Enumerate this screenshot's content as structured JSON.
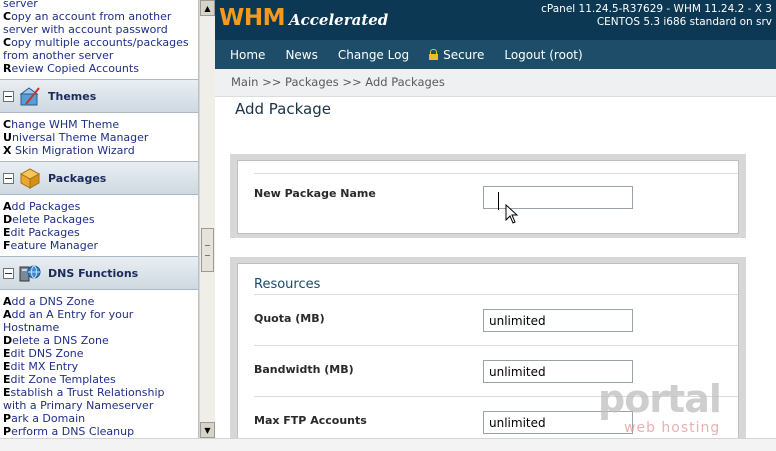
{
  "sidebar": {
    "top_links": [
      {
        "bold": "",
        "rest": "server"
      },
      {
        "bold": "C",
        "rest": "opy an account from another"
      },
      {
        "bold": "",
        "rest": "server with account password"
      },
      {
        "bold": "C",
        "rest": "opy multiple accounts/packages"
      },
      {
        "bold": "",
        "rest": "from another server"
      },
      {
        "bold": "R",
        "rest": "eview Copied Accounts"
      }
    ],
    "themes": {
      "label": "Themes",
      "links": [
        {
          "bold": "C",
          "rest": "hange WHM Theme"
        },
        {
          "bold": "U",
          "rest": "niversal Theme Manager"
        },
        {
          "bold": "X",
          "rest": " Skin Migration Wizard"
        }
      ]
    },
    "packages": {
      "label": "Packages",
      "links": [
        {
          "bold": "A",
          "rest": "dd Packages"
        },
        {
          "bold": "D",
          "rest": "elete Packages"
        },
        {
          "bold": "E",
          "rest": "dit Packages"
        },
        {
          "bold": "F",
          "rest": "eature Manager"
        }
      ]
    },
    "dns": {
      "label": "DNS Functions",
      "links": [
        {
          "bold": "A",
          "rest": "dd a DNS Zone"
        },
        {
          "bold": "A",
          "rest": "dd an A Entry for your"
        },
        {
          "bold": "",
          "rest": "Hostname"
        },
        {
          "bold": "D",
          "rest": "elete a DNS Zone"
        },
        {
          "bold": "E",
          "rest": "dit DNS Zone"
        },
        {
          "bold": "E",
          "rest": "dit MX Entry"
        },
        {
          "bold": "E",
          "rest": "dit Zone Templates"
        },
        {
          "bold": "E",
          "rest": "stablish a Trust Relationship"
        },
        {
          "bold": "",
          "rest": "with a Primary Nameserver"
        },
        {
          "bold": "P",
          "rest": "ark a Domain"
        },
        {
          "bold": "P",
          "rest": "erform a DNS Cleanup"
        }
      ]
    }
  },
  "header": {
    "logo_main": "WHM",
    "logo_sub": "Accelerated",
    "server_line1": "cPanel 11.24.5-R37629 - WHM 11.24.2 - X 3",
    "server_line2": "CENTOS 5.3 i686 standard on srv"
  },
  "nav": {
    "home": "Home",
    "news": "News",
    "changelog": "Change Log",
    "secure": "Secure",
    "logout": "Logout (root)"
  },
  "breadcrumb": "Main >> Packages >> Add Packages",
  "page_title": "Add Package",
  "form": {
    "package_name_label": "New Package Name",
    "package_name_value": "",
    "resources_title": "Resources",
    "quota_label": "Quota (MB)",
    "quota_value": "unlimited",
    "bandwidth_label": "Bandwidth (MB)",
    "bandwidth_value": "unlimited",
    "ftp_label": "Max FTP Accounts",
    "ftp_value": "unlimited"
  },
  "watermark": {
    "brand": "portal",
    "tagline": "web hosting"
  },
  "icons": {
    "themes": "paintbrush-icon",
    "packages": "box-icon",
    "dns": "network-icon",
    "secure": "lock-icon"
  }
}
